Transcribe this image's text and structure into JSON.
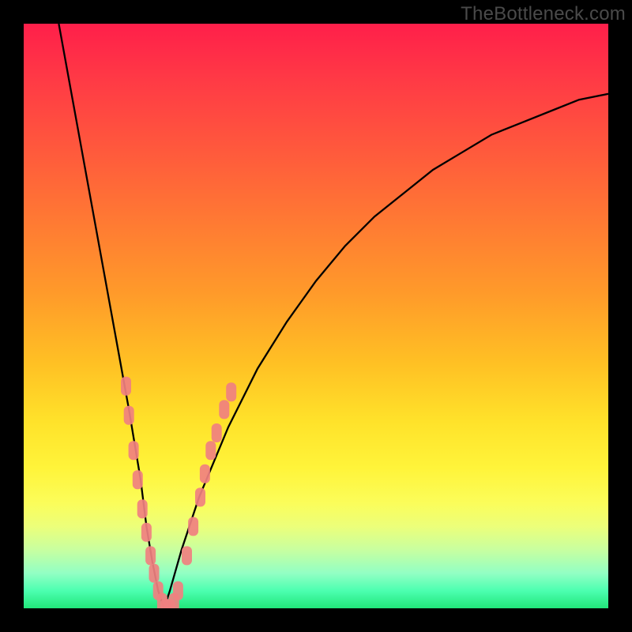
{
  "watermark": "TheBottleneck.com",
  "chart_data": {
    "type": "line",
    "title": "",
    "xlabel": "",
    "ylabel": "",
    "xlim": [
      0,
      100
    ],
    "ylim": [
      0,
      100
    ],
    "grid": false,
    "legend": false,
    "background_gradient": {
      "orientation": "vertical",
      "stops": [
        {
          "pos": 0.0,
          "color": "#ff1f4a"
        },
        {
          "pos": 0.5,
          "color": "#ffb024"
        },
        {
          "pos": 0.8,
          "color": "#fff43a"
        },
        {
          "pos": 1.0,
          "color": "#21e67a"
        }
      ]
    },
    "series": [
      {
        "name": "bottleneck-curve",
        "color": "#000000",
        "x": [
          6,
          8,
          10,
          12,
          14,
          16,
          18,
          20,
          21,
          22,
          23,
          24,
          25,
          27,
          30,
          35,
          40,
          45,
          50,
          55,
          60,
          65,
          70,
          75,
          80,
          85,
          90,
          95,
          100
        ],
        "y": [
          100,
          89,
          78,
          67,
          56,
          45,
          34,
          22,
          14,
          8,
          3,
          0,
          3,
          10,
          19,
          31,
          41,
          49,
          56,
          62,
          67,
          71,
          75,
          78,
          81,
          83,
          85,
          87,
          88
        ]
      }
    ],
    "markers": [
      {
        "name": "data-points",
        "color": "#f08080",
        "shape": "rounded-rect",
        "points": [
          {
            "x": 17.5,
            "y": 38
          },
          {
            "x": 18.0,
            "y": 33
          },
          {
            "x": 18.8,
            "y": 27
          },
          {
            "x": 19.5,
            "y": 22
          },
          {
            "x": 20.3,
            "y": 17
          },
          {
            "x": 21.0,
            "y": 13
          },
          {
            "x": 21.7,
            "y": 9
          },
          {
            "x": 22.3,
            "y": 6
          },
          {
            "x": 23.0,
            "y": 3
          },
          {
            "x": 23.7,
            "y": 1
          },
          {
            "x": 24.3,
            "y": 0
          },
          {
            "x": 25.0,
            "y": 0
          },
          {
            "x": 25.7,
            "y": 1
          },
          {
            "x": 26.4,
            "y": 3
          },
          {
            "x": 27.9,
            "y": 9
          },
          {
            "x": 29.0,
            "y": 14
          },
          {
            "x": 30.2,
            "y": 19
          },
          {
            "x": 31.0,
            "y": 23
          },
          {
            "x": 32.0,
            "y": 27
          },
          {
            "x": 33.0,
            "y": 30
          },
          {
            "x": 34.3,
            "y": 34
          },
          {
            "x": 35.5,
            "y": 37
          }
        ]
      }
    ]
  }
}
